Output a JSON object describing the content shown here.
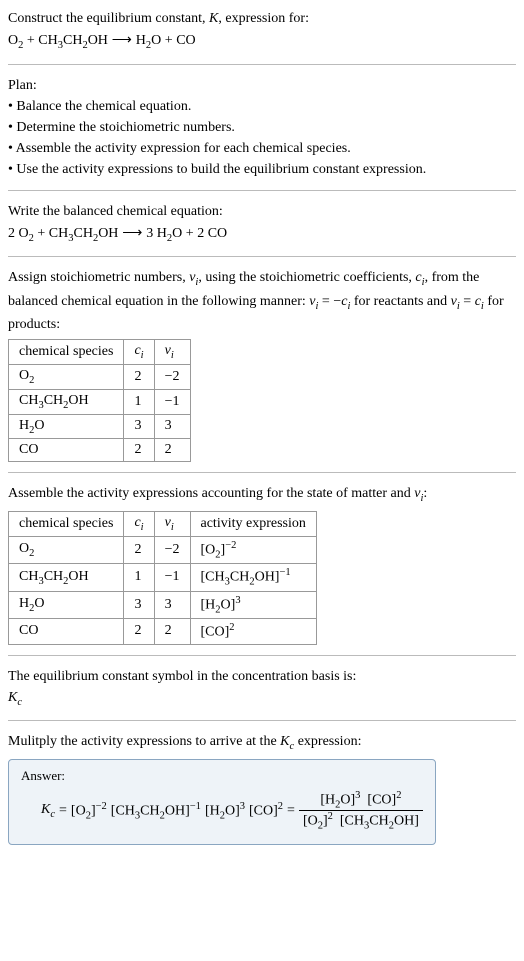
{
  "intro": {
    "line1_prefix": "Construct the equilibrium constant, ",
    "line1_K": "K",
    "line1_suffix": ", expression for:"
  },
  "eq1": {
    "O2": "O",
    "O2_sub": "2",
    "plus1": " + ",
    "ethanol": "CH",
    "e_sub1": "3",
    "e_mid": "CH",
    "e_sub2": "2",
    "e_oh": "OH",
    "arrow": " ⟶ ",
    "H2O": "H",
    "H2O_sub": "2",
    "H2O_o": "O",
    "plus2": " + ",
    "CO": "CO"
  },
  "plan": {
    "title": "Plan:",
    "b1": "• Balance the chemical equation.",
    "b2": "• Determine the stoichiometric numbers.",
    "b3": "• Assemble the activity expression for each chemical species.",
    "b4": "• Use the activity expressions to build the equilibrium constant expression."
  },
  "balanced": {
    "title": "Write the balanced chemical equation:",
    "c1": "2 ",
    "c2": "3 ",
    "c3": "2 "
  },
  "assign": {
    "line1a": "Assign stoichiometric numbers, ",
    "nu": "ν",
    "sub_i": "i",
    "line1b": ", using the stoichiometric coefficients, ",
    "c": "c",
    "line1c": ", from the balanced chemical equation in the following manner: ",
    "rel1": " = −",
    "line1d": " for reactants and ",
    "rel2": " = ",
    "line1e": " for products:"
  },
  "table1": {
    "h1": "chemical species",
    "h2_c": "c",
    "h2_i": "i",
    "h3_n": "ν",
    "h3_i": "i",
    "r1s": "O",
    "r1s_sub": "2",
    "r1c": "2",
    "r1n": "−2",
    "r2c": "1",
    "r2n": "−1",
    "r3s": "H",
    "r3s_sub": "2",
    "r3s_o": "O",
    "r3c": "3",
    "r3n": "3",
    "r4s": "CO",
    "r4c": "2",
    "r4n": "2"
  },
  "assemble": {
    "line_a": "Assemble the activity expressions accounting for the state of matter and ",
    "line_b": ":"
  },
  "table2": {
    "h4": "activity expression",
    "r1a_pre": "[O",
    "r1a_sub": "2",
    "r1a_post": "]",
    "r1a_exp": "−2",
    "r2a_pre": "[CH",
    "r2a_s1": "3",
    "r2a_m": "CH",
    "r2a_s2": "2",
    "r2a_oh": "OH]",
    "r2a_exp": "−1",
    "r3a_pre": "[H",
    "r3a_sub": "2",
    "r3a_post": "O]",
    "r3a_exp": "3",
    "r4a_pre": "[CO]",
    "r4a_exp": "2"
  },
  "kc_line": {
    "text": "The equilibrium constant symbol in the concentration basis is:",
    "K": "K",
    "c": "c"
  },
  "multiply": {
    "line_a": "Mulitply the activity expressions to arrive at the ",
    "line_b": " expression:"
  },
  "answer": {
    "label": "Answer:",
    "eq": " = ",
    "eq2": " = "
  },
  "chart_data": {
    "type": "table",
    "tables": [
      {
        "title": "Stoichiometric numbers",
        "columns": [
          "chemical species",
          "c_i",
          "ν_i"
        ],
        "rows": [
          [
            "O2",
            2,
            -2
          ],
          [
            "CH3CH2OH",
            1,
            -1
          ],
          [
            "H2O",
            3,
            3
          ],
          [
            "CO",
            2,
            2
          ]
        ]
      },
      {
        "title": "Activity expressions",
        "columns": [
          "chemical species",
          "c_i",
          "ν_i",
          "activity expression"
        ],
        "rows": [
          [
            "O2",
            2,
            -2,
            "[O2]^-2"
          ],
          [
            "CH3CH2OH",
            1,
            -1,
            "[CH3CH2OH]^-1"
          ],
          [
            "H2O",
            3,
            3,
            "[H2O]^3"
          ],
          [
            "CO",
            2,
            2,
            "[CO]^2"
          ]
        ]
      }
    ]
  }
}
